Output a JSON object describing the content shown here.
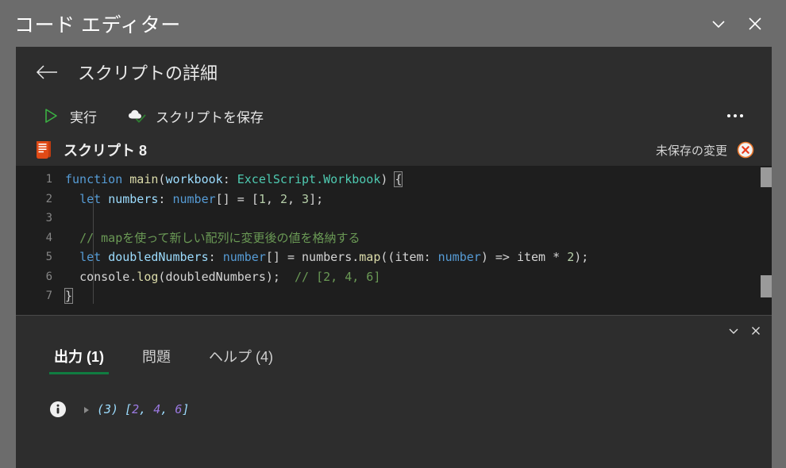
{
  "window": {
    "title": "コード エディター",
    "controls": [
      {
        "name": "collapse-window-button",
        "icon": "chevron-down-icon"
      },
      {
        "name": "close-window-button",
        "icon": "close-icon"
      }
    ]
  },
  "panel": {
    "back_icon": "back-arrow-icon",
    "title": "スクリプトの詳細"
  },
  "toolbar": {
    "run_label": "実行",
    "run_icon": "play-icon",
    "save_label": "スクリプトを保存",
    "save_icon": "cloud-save-icon",
    "overflow_icon": "more-options-icon"
  },
  "script": {
    "icon": "script-file-icon",
    "name": "スクリプト 8",
    "unsaved_label": "未保存の変更",
    "unsaved_icon": "error-circle-icon"
  },
  "code": {
    "lines": [
      {
        "n": "1",
        "text": "function main(workbook: ExcelScript.Workbook) {"
      },
      {
        "n": "2",
        "text": "  let numbers: number[] = [1, 2, 3];"
      },
      {
        "n": "3",
        "text": ""
      },
      {
        "n": "4",
        "text": "  // mapを使って新しい配列に変更後の値を格納する"
      },
      {
        "n": "5",
        "text": "  let doubledNumbers: number[] = numbers.map((item: number) => item * 2);"
      },
      {
        "n": "6",
        "text": "  console.log(doubledNumbers);  // [2, 4, 6]"
      },
      {
        "n": "7",
        "text": "}"
      }
    ],
    "tokens": {
      "l1": {
        "kw": "function",
        "fn": "main",
        "p1": "(",
        "var": "workbook",
        "colon": ": ",
        "typ": "ExcelScript.Workbook",
        "p2": ")",
        "brace": "{"
      },
      "l2": {
        "kw": "let",
        "var": "numbers",
        "colon": ": ",
        "typ": "number",
        "arr": "[]",
        "eq": " = ",
        "b1": "[",
        "n1": "1",
        "c1": ", ",
        "n2": "2",
        "c2": ", ",
        "n3": "3",
        "b2": "]",
        "semi": ";"
      },
      "l4": {
        "cmt": "// mapを使って新しい配列に変更後の値を格納する"
      },
      "l5": {
        "kw": "let",
        "var": "doubledNumbers",
        "colon": ": ",
        "typ": "number",
        "arr": "[]",
        "eq": " = ",
        "obj": "numbers",
        "dot": ".",
        "fn": "map",
        "p1": "((",
        "param": "item",
        "colon2": ": ",
        "typ2": "number",
        "p2": ")",
        "arrow": " => ",
        "expr": "item * ",
        "n": "2",
        "p3": ")",
        "semi": ";"
      },
      "l6": {
        "obj": "console",
        "dot": ".",
        "fn": "log",
        "p1": "(",
        "arg": "doubledNumbers",
        "p2": ")",
        "semi": ";",
        "cmt": "  // [2, 4, 6]"
      },
      "l7": {
        "brace": "}"
      }
    }
  },
  "output": {
    "controls": [
      {
        "name": "collapse-output-button",
        "icon": "chevron-down-icon"
      },
      {
        "name": "close-output-button",
        "icon": "close-icon"
      }
    ],
    "tabs": [
      {
        "label": "出力 (1)",
        "active": true,
        "name": "tab-output"
      },
      {
        "label": "問題",
        "active": false,
        "name": "tab-problems"
      },
      {
        "label": "ヘルプ (4)",
        "active": false,
        "name": "tab-help"
      }
    ],
    "entry": {
      "icon": "info-icon",
      "expander": "expand-triangle-icon",
      "count": "(3)",
      "bracket_open": "[",
      "values": [
        "2",
        "4",
        "6"
      ],
      "bracket_close": "]"
    }
  },
  "colors": {
    "window_bg": "#6c6c6c",
    "panel_bg": "#2d2d2d",
    "editor_bg": "#1e1e1e",
    "accent_green": "#107c41",
    "run_green": "#3bb143",
    "script_orange": "#e04a16",
    "unsaved_orange": "#e8762c"
  }
}
